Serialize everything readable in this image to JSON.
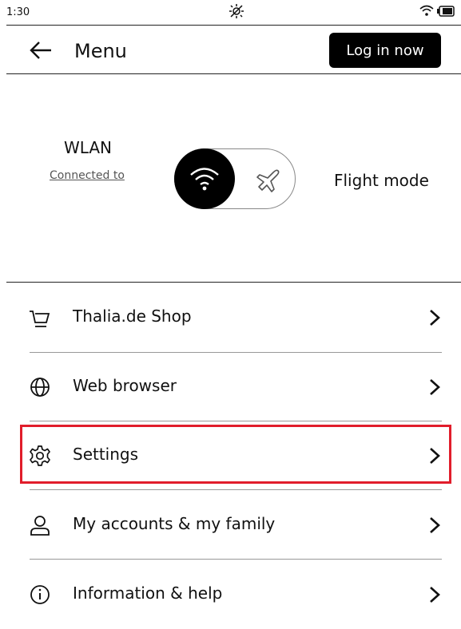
{
  "status": {
    "time": "1:30"
  },
  "header": {
    "title": "Menu",
    "login_label": "Log in now"
  },
  "connectivity": {
    "wlan_label": "WLAN",
    "connected_label": "Connected to",
    "flight_label": "Flight mode",
    "wifi_on": true
  },
  "menu": {
    "items": [
      {
        "label": "Thalia.de Shop",
        "icon": "cart-icon"
      },
      {
        "label": "Web browser",
        "icon": "globe-icon"
      },
      {
        "label": "Settings",
        "icon": "gear-icon"
      },
      {
        "label": "My accounts & my family",
        "icon": "user-icon"
      },
      {
        "label": "Information & help",
        "icon": "info-icon"
      }
    ]
  },
  "colors": {
    "highlight": "#e11d2b",
    "button_bg": "#000000"
  }
}
